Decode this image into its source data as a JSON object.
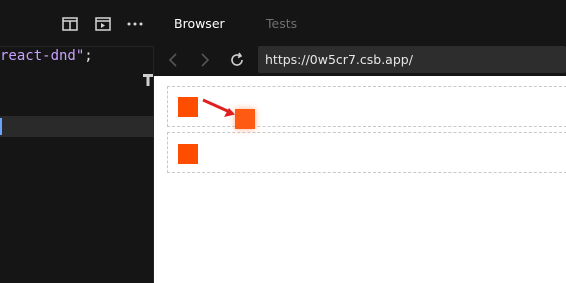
{
  "editor": {
    "toolbar": {
      "split_icon": "split-view-icon",
      "preview_icon": "preview-icon",
      "more_icon": "more-icon"
    },
    "code": {
      "line1_string": "react-dnd\"",
      "line1_punct": ";"
    }
  },
  "browser": {
    "tabs": [
      "Browser",
      "Tests"
    ],
    "active_tab": "Browser",
    "url": "https://0w5cr7.csb.app/"
  },
  "colors": {
    "square": "#ff4d00",
    "arrow": "#e02020",
    "string": "#c8a2ff"
  }
}
